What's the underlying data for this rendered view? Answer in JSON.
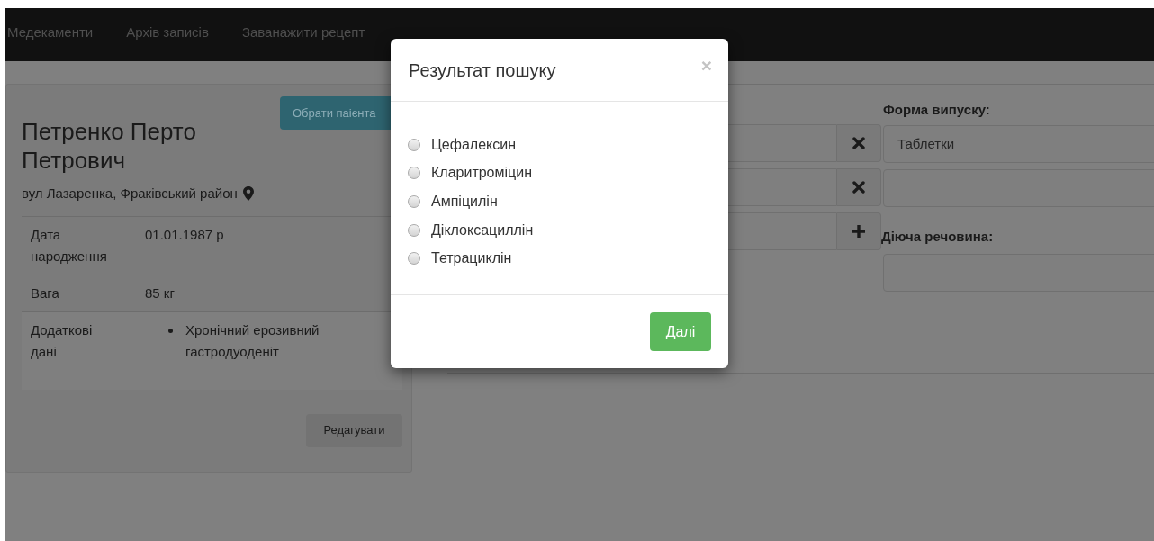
{
  "navbar": {
    "items": [
      {
        "label": "Медекаменти"
      },
      {
        "label": "Архів записів"
      },
      {
        "label": "Заванажити рецепт"
      }
    ]
  },
  "patient": {
    "select_button": "Обрати паієнта",
    "name": "Петренко Перто Петрович",
    "address": "вул Лазаренка, Фраківський район",
    "details": [
      {
        "label": "Дата народження",
        "value": "01.01.1987 р"
      },
      {
        "label": "Вага",
        "value": "85 кг"
      },
      {
        "label": "Додаткові дані",
        "items": [
          "Хронічний ерозивний гастродуоденіт"
        ]
      }
    ],
    "edit_button": "Редагувати"
  },
  "prescription": {
    "input_groups": [
      {
        "kind": "remove"
      },
      {
        "kind": "remove"
      },
      {
        "kind": "add"
      }
    ],
    "form_label": "Форма випуску:",
    "form_value": "Таблетки",
    "substance_label": "Діюча речовина:"
  },
  "modal": {
    "title": "Результат пошуку",
    "close": "×",
    "options": [
      {
        "label": "Цефалексин",
        "selected": false
      },
      {
        "label": "Кларитроміцин",
        "selected": false
      },
      {
        "label": "Ампіцилін",
        "selected": false
      },
      {
        "label": "Діклоксациллін",
        "selected": false
      },
      {
        "label": "Тетрациклін",
        "selected": false
      }
    ],
    "next_button": "Далі"
  }
}
